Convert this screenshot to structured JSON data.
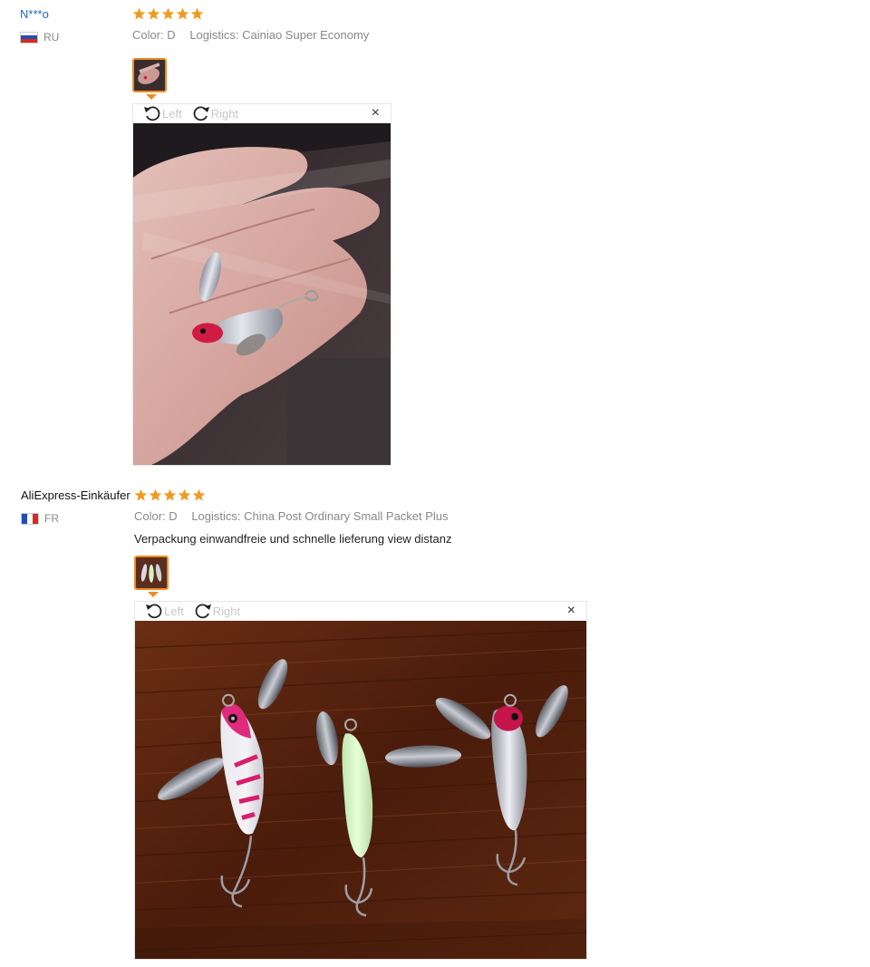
{
  "reviews": [
    {
      "user": "N***o",
      "country": "RU",
      "rating": 5,
      "color_label": "Color: D",
      "logistics_label": "Logistics: Cainiao Super Economy",
      "feedback": "",
      "viewer": {
        "rotate_left": "Left",
        "rotate_right": "Right",
        "close": "×"
      }
    },
    {
      "user": "AliExpress-Einkäufer",
      "country": "FR",
      "rating": 5,
      "color_label": "Color: D",
      "logistics_label": "Logistics: China Post Ordinary Small Packet Plus",
      "feedback": "Verpackung einwandfreie und schnelle lieferung view distanz",
      "viewer": {
        "rotate_left": "Left",
        "rotate_right": "Right",
        "close": "×"
      }
    }
  ],
  "colors": {
    "star": "#f29a1f",
    "link": "#1a66c9",
    "thumb_border": "#f08a24",
    "muted": "#888888"
  },
  "icons": {
    "star": "star-icon",
    "rotate_left": "rotate-left-icon",
    "rotate_right": "rotate-right-icon",
    "close": "close-icon"
  }
}
